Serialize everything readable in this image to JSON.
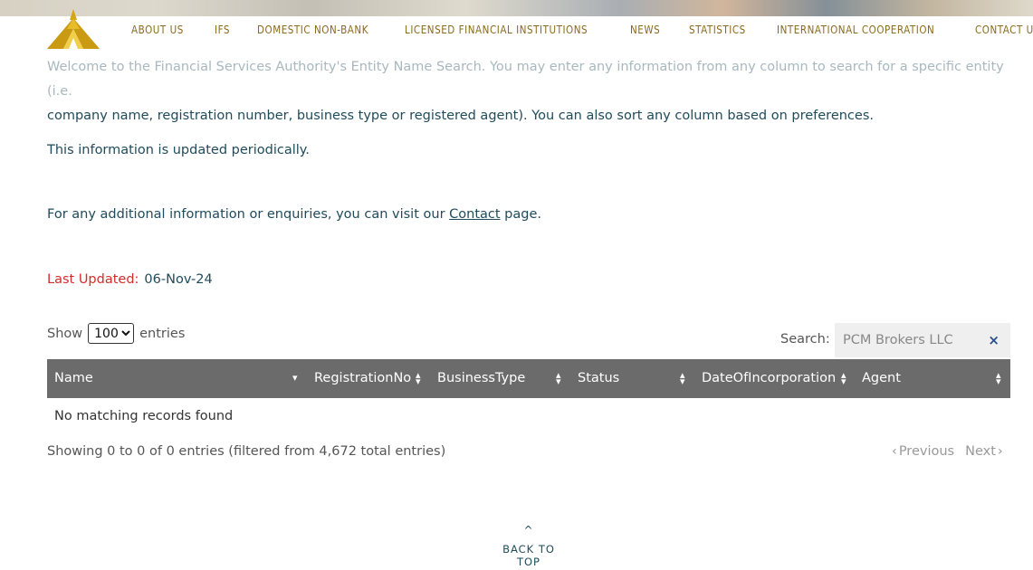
{
  "nav": {
    "items": [
      "ABOUT US",
      "IFS",
      "DOMESTIC NON-BANK",
      "LICENSED FINANCIAL INSTITUTIONS",
      "NEWS",
      "STATISTICS",
      "INTERNATIONAL COOPERATION",
      "CONTACT US"
    ]
  },
  "intro": {
    "line1": "Welcome to the Financial Services Authority's Entity Name Search. You may enter any information from any column to search for a specific entity (i.e.",
    "line2": "company name, registration number, business type or registered agent). You can also sort any column based on preferences."
  },
  "updated_note": "This information is updated periodically.",
  "contact_note": {
    "before": "For any additional information or enquiries, you can visit our ",
    "link": "Contact",
    "after": " page."
  },
  "last_updated": {
    "label": "Last Updated:",
    "value": "06-Nov-24"
  },
  "length": {
    "show": "Show",
    "selected": "100",
    "entries": "entries"
  },
  "search": {
    "label": "Search:",
    "value": "PCM Brokers LLC",
    "clear": "×"
  },
  "table": {
    "columns": [
      "Name",
      "RegistrationNo",
      "BusinessType",
      "Status",
      "DateOfIncorporation",
      "Agent"
    ],
    "empty": "No matching records found"
  },
  "info": "Showing 0 to 0 of 0 entries (filtered from 4,672 total entries)",
  "pager": {
    "previous": "Previous",
    "next": "Next"
  },
  "back_to_top": "BACK TO TOP"
}
